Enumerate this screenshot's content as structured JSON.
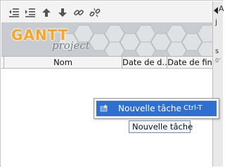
{
  "toolbar": {
    "buttons": [
      {
        "name": "unindent-icon"
      },
      {
        "name": "indent-icon"
      },
      {
        "name": "arrow-up-icon"
      },
      {
        "name": "arrow-down-icon"
      },
      {
        "name": "link-icon"
      },
      {
        "name": "unlink-icon"
      }
    ]
  },
  "banner": {
    "logo_main": "GANTT",
    "logo_sub": "project"
  },
  "table": {
    "columns": [
      "Nom",
      "Date de d...",
      "Date de fin"
    ]
  },
  "right_edge": {
    "fragments": [
      "A",
      "j",
      "s",
      "0'"
    ]
  },
  "context_menu": {
    "item_label": "Nouvelle tâche",
    "item_shortcut": "Ctrl-T",
    "selection_color": "#2f6fd0"
  },
  "tooltip": {
    "text": "Nouvelle tâche"
  },
  "colors": {
    "logo_orange": "#f7a623",
    "banner_bg": "#c8ccd0"
  }
}
